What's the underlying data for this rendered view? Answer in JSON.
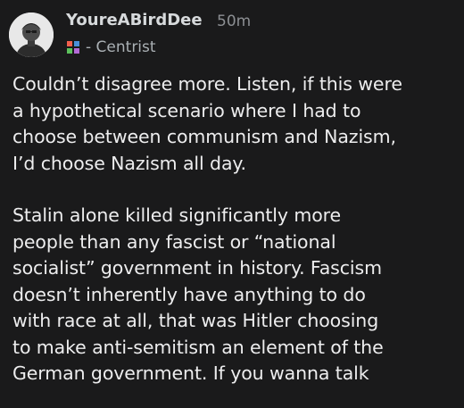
{
  "comment": {
    "username": "YoureABirdDee",
    "timestamp": "50m",
    "flair_prefix": "- ",
    "flair": "Centrist",
    "flair_icon": "political-compass-icon",
    "avatar_icon": "user-avatar",
    "paragraphs": [
      "Couldn’t disagree more. Listen, if this were\na hypothetical scenario where I had to\nchoose between communism and Nazism,\nI’d choose Nazism all day.",
      "Stalin alone killed significantly more\npeople than any fascist or “national\nsocialist” government in history. Fascism\ndoesn’t inherently have anything to do\nwith race at all, that was Hitler choosing\nto make anti-semitism an element of the\nGerman government. If you wanna talk"
    ]
  },
  "colors": {
    "background": "#1a1a1b",
    "username": "#d7dadc",
    "meta": "#8c8f93",
    "body": "#ededee",
    "compass_red": "#f25f4d",
    "compass_blue": "#4a90d9",
    "compass_green": "#5cc25c",
    "compass_purple": "#b36bd6"
  }
}
